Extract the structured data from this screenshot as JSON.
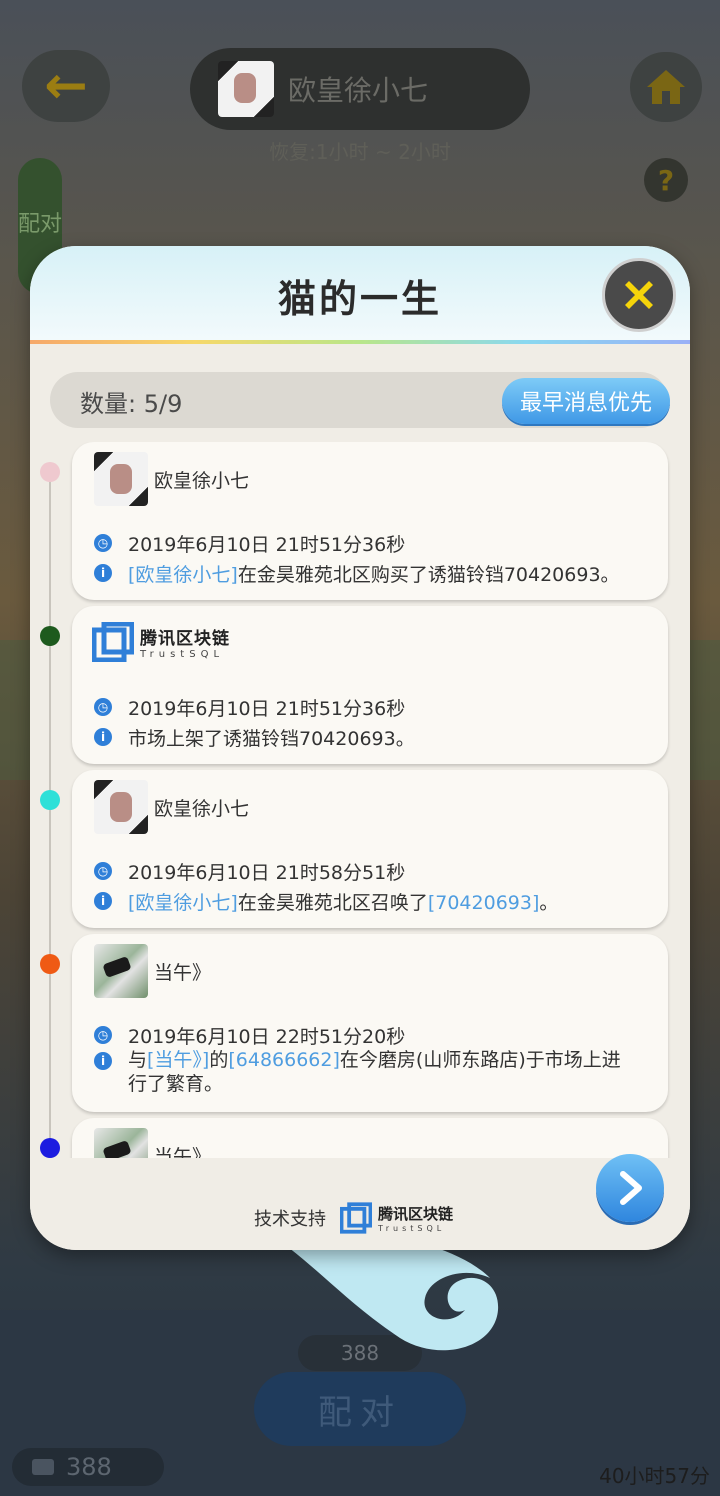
{
  "header": {
    "player_name": "欧皇徐小七",
    "recover_text": "恢复:1小时 ~ 2小时",
    "side_tab_label": "配对",
    "help_label": "?"
  },
  "modal": {
    "title": "猫的一生",
    "count_label": "数量: 5/9",
    "sort_button": "最早消息优先",
    "events": [
      {
        "dot_color": "#efc9cf",
        "actor": "欧皇徐小七",
        "time": "2019年6月10日 21时51分36秒",
        "desc_parts": [
          "[欧皇徐小七]",
          "在金昊雅苑北区购买了诱猫铃铛70420693。"
        ]
      },
      {
        "dot_color": "#1e5a1e",
        "brand_cn": "腾讯区块链",
        "brand_en": "TrustSQL",
        "time": "2019年6月10日 21时51分36秒",
        "desc": "市场上架了诱猫铃铛70420693。"
      },
      {
        "dot_color": "#2ee0d8",
        "actor": "欧皇徐小七",
        "time": "2019年6月10日 21时58分51秒",
        "desc_parts": [
          "[欧皇徐小七]",
          "在金昊雅苑北区召唤了",
          "[70420693]",
          "。"
        ]
      },
      {
        "dot_color": "#ef5a14",
        "actor": "当午》",
        "time": "2019年6月10日 22时51分20秒",
        "desc_parts": [
          "与",
          "[当午》]",
          "的",
          "[64866662]",
          "在今磨房(山师东路店)于市场上进",
          "行了繁育。"
        ]
      },
      {
        "dot_color": "#1c1ce0",
        "actor": "当午》"
      }
    ],
    "footer": {
      "support_label": "技术支持",
      "brand_cn": "腾讯区块链",
      "brand_en": "TrustSQL"
    }
  },
  "bottom": {
    "cost": "388",
    "pair_button": "配对",
    "coins": "388",
    "timer": "40小时57分"
  },
  "colors": {
    "accent_blue": "#3f98e6",
    "link_blue": "#4f9de0",
    "close_yellow": "#f5d40a"
  }
}
